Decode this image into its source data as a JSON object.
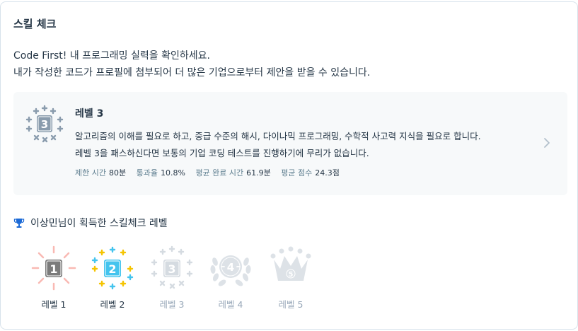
{
  "section_title": "스킬 체크",
  "intro": {
    "line1": "Code First! 내 프로그래밍 실력을 확인하세요.",
    "line2": "내가 작성한 코드가 프로필에 첨부되어 더 많은 기업으로부터 제안을 받을 수 있습니다."
  },
  "current_level": {
    "name": "레벨 3",
    "badge_number": "3",
    "desc_line1": "알고리즘의 이해를 필요로 하고, 중급 수준의 해시, 다이나믹 프로그래밍, 수학적 사고력 지식을 필요로 합니다.",
    "desc_line2": "레벨 3을 패스하신다면 보통의 기업 코딩 테스트를 진행하기에 무리가 없습니다.",
    "stats": [
      {
        "label": "제한 시간",
        "value": "80분"
      },
      {
        "label": "통과율",
        "value": "10.8%"
      },
      {
        "label": "평균 완료 시간",
        "value": "61.9분"
      },
      {
        "label": "평균 점수",
        "value": "24.3점"
      }
    ]
  },
  "earned_title": "이상민님이 획득한 스킬체크 레벨",
  "badges": [
    {
      "label": "레벨 1",
      "number": "1",
      "earned": true
    },
    {
      "label": "레벨 2",
      "number": "2",
      "earned": true
    },
    {
      "label": "레벨 3",
      "number": "3",
      "earned": false
    },
    {
      "label": "레벨 4",
      "number": "4",
      "earned": false
    },
    {
      "label": "레벨 5",
      "number": "5",
      "earned": false
    }
  ],
  "colors": {
    "text": "#263747",
    "muted": "#98a8b9",
    "level1_ray": "#f9b9b3",
    "level1_tile": "#7b7b7b",
    "level2_tile": "#44c4ee",
    "level2_plus": "#f5c400",
    "locked": "#d5dbe1",
    "current_badge": "#8a9cad",
    "trophy": "#1c6ad6"
  },
  "icons": [
    "trophy-icon",
    "chevron-right-icon"
  ]
}
